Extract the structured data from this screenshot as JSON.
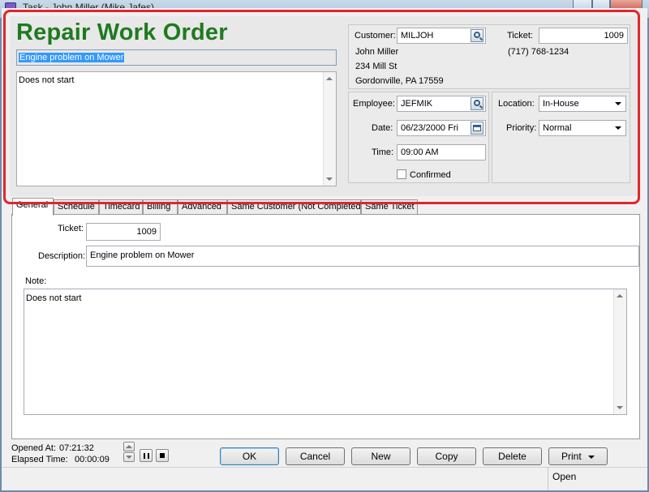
{
  "window": {
    "title": "Task - John Miller (Mike Jafes)"
  },
  "header": {
    "heading": "Repair Work Order",
    "subject": "Engine problem on Mower",
    "note": "Does not start"
  },
  "customer": {
    "label": "Customer:",
    "code": "MILJOH",
    "name": "John Miller",
    "address1": "234 Mill St",
    "address2": "Gordonville, PA 17559",
    "ticket_label": "Ticket:",
    "ticket": "1009",
    "phone": "(717) 768-1234"
  },
  "schedule": {
    "employee_label": "Employee:",
    "employee": "JEFMIK",
    "date_label": "Date:",
    "date": "06/23/2000 Fri",
    "time_label": "Time:",
    "time": "09:00 AM",
    "confirmed_label": "Confirmed",
    "confirmed": false,
    "location_label": "Location:",
    "location": "In-House",
    "priority_label": "Priority:",
    "priority": "Normal"
  },
  "tabs": [
    {
      "label": "General"
    },
    {
      "label": "Schedule"
    },
    {
      "label": "Timecard"
    },
    {
      "label": "Billing"
    },
    {
      "label": "Advanced"
    },
    {
      "label": "Same Customer (Not Completed)"
    },
    {
      "label": "Same Ticket"
    }
  ],
  "general": {
    "ticket_label": "Ticket:",
    "ticket": "1009",
    "description_label": "Description:",
    "description": "Engine problem on Mower",
    "note_label": "Note:",
    "note": "Does not start"
  },
  "footer": {
    "opened_label": "Opened At:",
    "opened": "07:21:32",
    "elapsed_label": "Elapsed Time:",
    "elapsed": "00:00:09",
    "buttons": {
      "ok": "OK",
      "cancel": "Cancel",
      "new": "New",
      "copy": "Copy",
      "delete": "Delete",
      "print": "Print"
    }
  },
  "status": {
    "state": "Open"
  },
  "colors": {
    "heading": "#1f7a1f",
    "highlight": "#e0262c",
    "selection": "#3399ff"
  }
}
